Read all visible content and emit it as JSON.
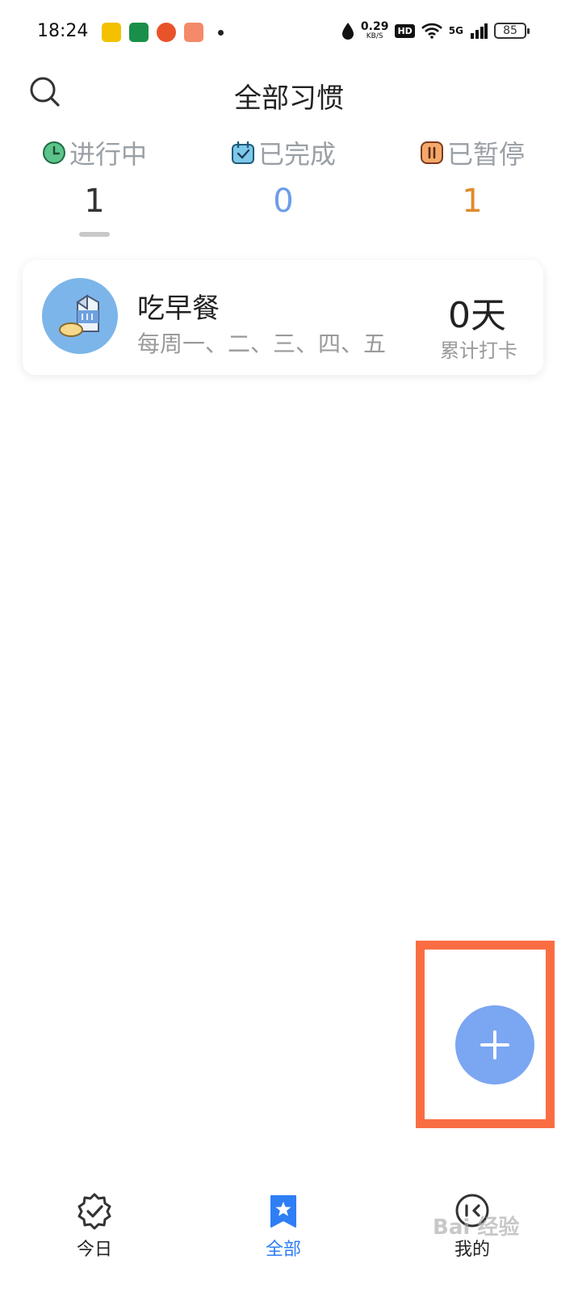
{
  "status_bar": {
    "time": "18:24",
    "net_speed_value": "0.29",
    "net_speed_unit": "KB/S",
    "hd_badge": "HD",
    "signal_label": "5G",
    "battery": "85",
    "icons": [
      "notification-app-icon",
      "oppo-app-icon",
      "orange-app-icon",
      "game-app-icon",
      "dot-icon",
      "water-drop-icon",
      "wifi-icon",
      "signal-icon",
      "battery-icon"
    ]
  },
  "header": {
    "title": "全部习惯",
    "search_icon": "search-icon"
  },
  "stats": {
    "tabs": [
      {
        "label": "进行中",
        "count": "1",
        "icon": "clock-icon",
        "color": "#333333"
      },
      {
        "label": "已完成",
        "count": "0",
        "icon": "calendar-check-icon",
        "color": "#6d9de6"
      },
      {
        "label": "已暂停",
        "count": "1",
        "icon": "pause-icon",
        "color": "#e08a2c"
      }
    ]
  },
  "habits": [
    {
      "name": "吃早餐",
      "schedule": "每周一、二、三、四、五",
      "count": "0天",
      "count_label": "累计打卡",
      "icon": "milk-bread-icon"
    }
  ],
  "fab": {
    "icon": "plus-icon",
    "color": "#7ba6f1"
  },
  "highlight_color": "#fa6d43",
  "bottom_nav": {
    "items": [
      {
        "label": "今日",
        "icon": "check-badge-icon",
        "active": false
      },
      {
        "label": "全部",
        "icon": "star-bookmark-icon",
        "active": true
      },
      {
        "label": "我的",
        "icon": "face-icon",
        "active": false
      }
    ]
  },
  "watermark": "Bai 经验"
}
